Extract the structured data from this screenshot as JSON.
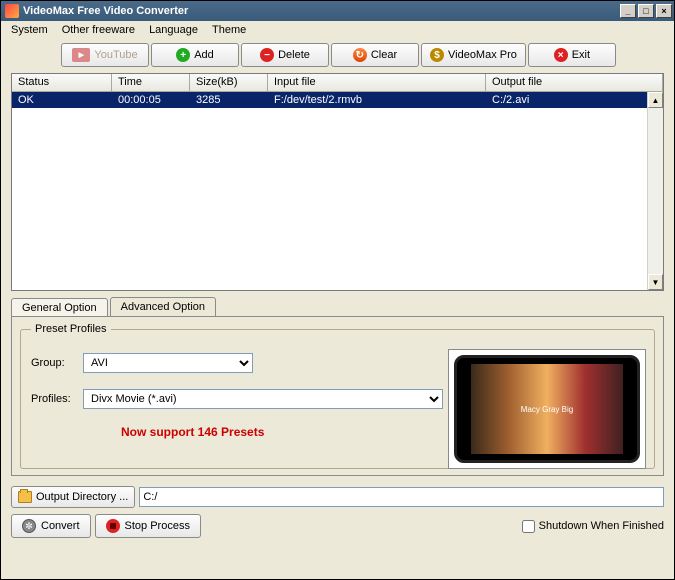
{
  "window": {
    "title": "VideoMax Free Video Converter"
  },
  "menu": {
    "system": "System",
    "other": "Other freeware",
    "language": "Language",
    "theme": "Theme"
  },
  "toolbar": {
    "youtube": "YouTube",
    "add": "Add",
    "delete": "Delete",
    "clear": "Clear",
    "pro": "VideoMax Pro",
    "exit": "Exit"
  },
  "columns": {
    "status": "Status",
    "time": "Time",
    "size": "Size(kB)",
    "input": "Input file",
    "output": "Output file"
  },
  "rows": [
    {
      "status": "OK",
      "time": "00:00:05",
      "size": "3285",
      "input": "F:/dev/test/2.rmvb",
      "output": "C:/2.avi"
    }
  ],
  "tabs": {
    "general": "General Option",
    "advanced": "Advanced Option"
  },
  "fieldset": {
    "legend": "Preset Profiles"
  },
  "labels": {
    "group": "Group:",
    "profiles": "Profiles:"
  },
  "group": {
    "value": "AVI"
  },
  "profile": {
    "value": "Divx Movie (*.avi)"
  },
  "preset_note": "Now support 146 Presets",
  "preview_caption": "Macy Gray\nBig",
  "outdir": {
    "btn": "Output Directory ...",
    "value": "C:/"
  },
  "actions": {
    "convert": "Convert",
    "stop": "Stop Process"
  },
  "shutdown": {
    "label": "Shutdown When Finished"
  }
}
